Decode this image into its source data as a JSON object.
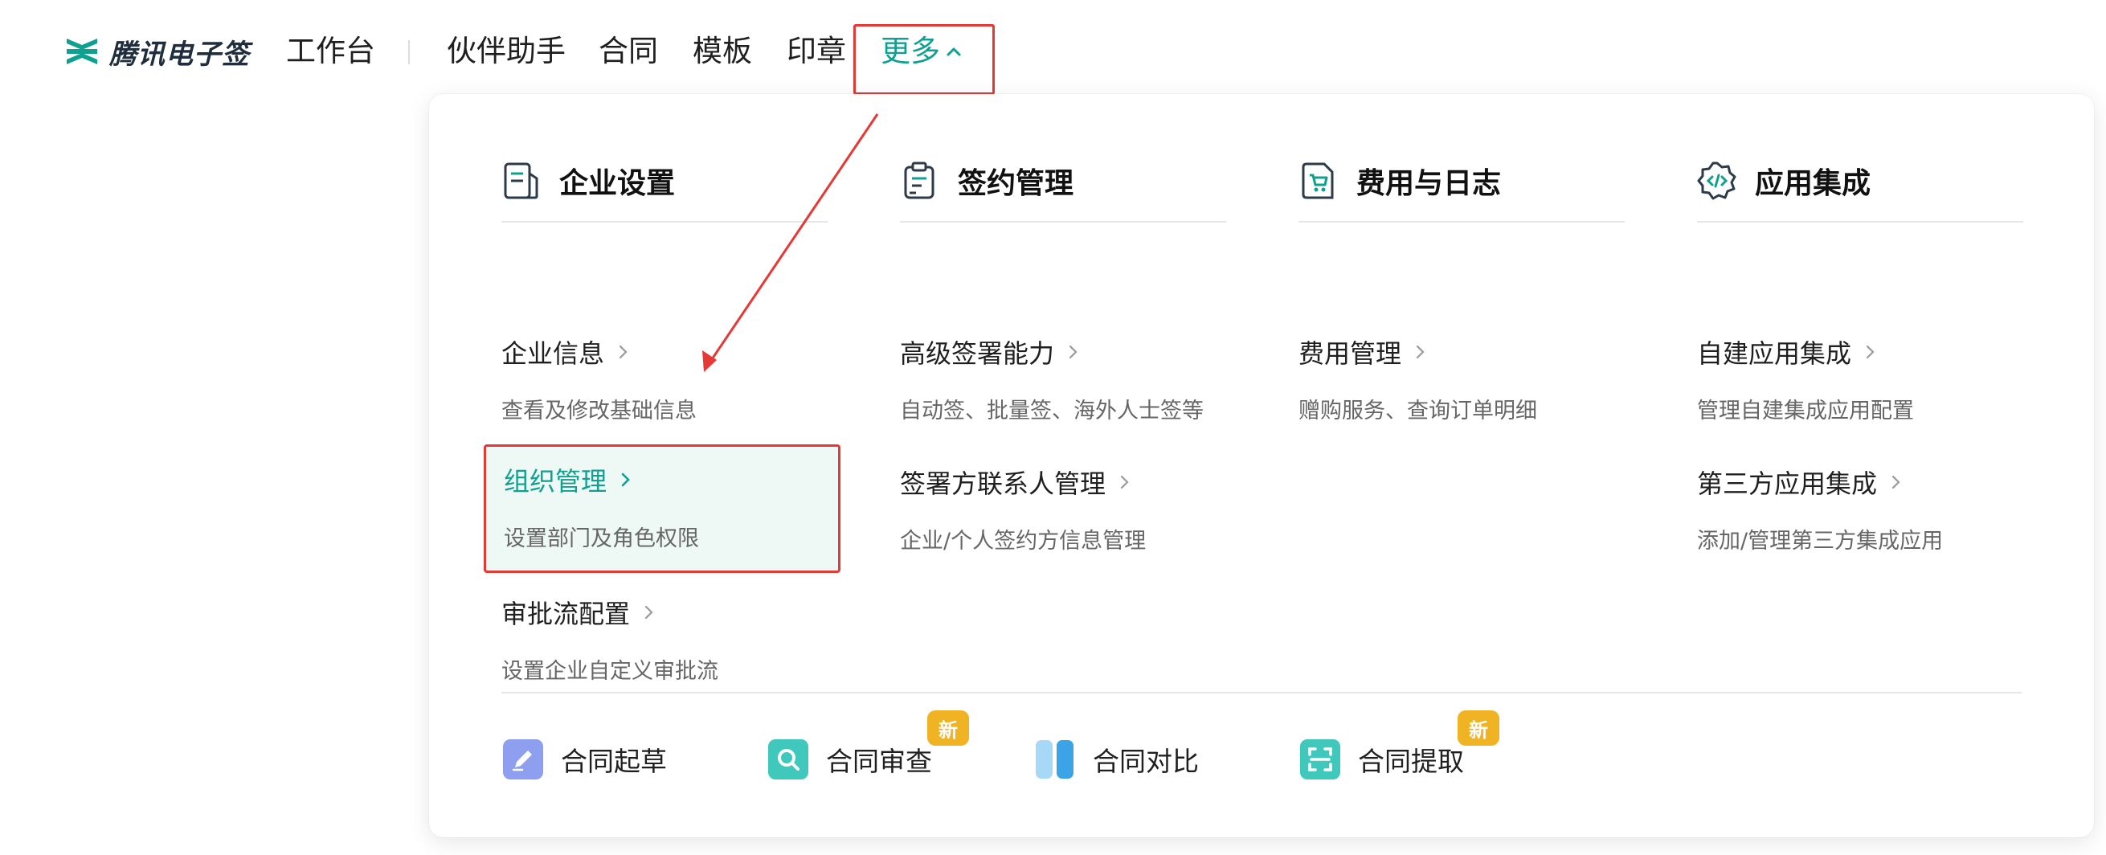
{
  "app": {
    "logo_text": "腾讯电子签",
    "logo_icon": "tencent-esign-logo-icon",
    "brand_color": "#10a090",
    "highlight_color": "#e53935"
  },
  "nav": {
    "workbench": "工作台",
    "partner": "伙伴助手",
    "contract": "合同",
    "template": "模板",
    "seal": "印章",
    "more": "更多",
    "more_icon": "chevron-up-icon"
  },
  "menu": {
    "columns": [
      {
        "title": "企业设置",
        "icon": "enterprise-doc-icon",
        "items": [
          {
            "title": "企业信息",
            "desc": "查看及修改基础信息"
          },
          {
            "title": "组织管理",
            "desc": "设置部门及角色权限",
            "active": true
          },
          {
            "title": "审批流配置",
            "desc": "设置企业自定义审批流"
          }
        ]
      },
      {
        "title": "签约管理",
        "icon": "clipboard-sign-icon",
        "items": [
          {
            "title": "高级签署能力",
            "desc": "自动签、批量签、海外人士签等"
          },
          {
            "title": "签署方联系人管理",
            "desc": "企业/个人签约方信息管理"
          }
        ]
      },
      {
        "title": "费用与日志",
        "icon": "cart-bill-icon",
        "items": [
          {
            "title": "费用管理",
            "desc": "赠购服务、查询订单明细"
          }
        ]
      },
      {
        "title": "应用集成",
        "icon": "code-gear-icon",
        "items": [
          {
            "title": "自建应用集成",
            "desc": "管理自建集成应用配置"
          },
          {
            "title": "第三方应用集成",
            "desc": "添加/管理第三方集成应用"
          }
        ]
      }
    ],
    "tools": [
      {
        "label": "合同起草",
        "icon": "pen-draft-icon",
        "badge": ""
      },
      {
        "label": "合同审查",
        "icon": "magnifier-review-icon",
        "badge": "新"
      },
      {
        "label": "合同对比",
        "icon": "compare-columns-icon",
        "badge": ""
      },
      {
        "label": "合同提取",
        "icon": "scan-extract-icon",
        "badge": "新"
      }
    ]
  }
}
